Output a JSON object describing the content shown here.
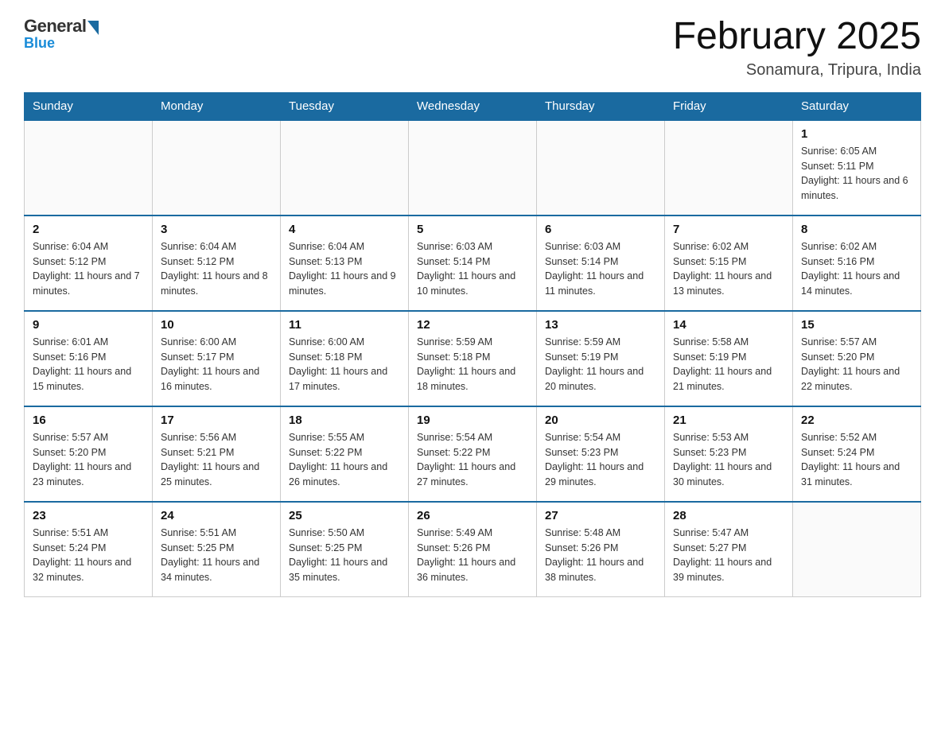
{
  "header": {
    "logo": {
      "general": "General",
      "blue": "Blue"
    },
    "title": "February 2025",
    "location": "Sonamura, Tripura, India"
  },
  "weekdays": [
    "Sunday",
    "Monday",
    "Tuesday",
    "Wednesday",
    "Thursday",
    "Friday",
    "Saturday"
  ],
  "weeks": [
    [
      {
        "day": "",
        "info": ""
      },
      {
        "day": "",
        "info": ""
      },
      {
        "day": "",
        "info": ""
      },
      {
        "day": "",
        "info": ""
      },
      {
        "day": "",
        "info": ""
      },
      {
        "day": "",
        "info": ""
      },
      {
        "day": "1",
        "info": "Sunrise: 6:05 AM\nSunset: 5:11 PM\nDaylight: 11 hours and 6 minutes."
      }
    ],
    [
      {
        "day": "2",
        "info": "Sunrise: 6:04 AM\nSunset: 5:12 PM\nDaylight: 11 hours and 7 minutes."
      },
      {
        "day": "3",
        "info": "Sunrise: 6:04 AM\nSunset: 5:12 PM\nDaylight: 11 hours and 8 minutes."
      },
      {
        "day": "4",
        "info": "Sunrise: 6:04 AM\nSunset: 5:13 PM\nDaylight: 11 hours and 9 minutes."
      },
      {
        "day": "5",
        "info": "Sunrise: 6:03 AM\nSunset: 5:14 PM\nDaylight: 11 hours and 10 minutes."
      },
      {
        "day": "6",
        "info": "Sunrise: 6:03 AM\nSunset: 5:14 PM\nDaylight: 11 hours and 11 minutes."
      },
      {
        "day": "7",
        "info": "Sunrise: 6:02 AM\nSunset: 5:15 PM\nDaylight: 11 hours and 13 minutes."
      },
      {
        "day": "8",
        "info": "Sunrise: 6:02 AM\nSunset: 5:16 PM\nDaylight: 11 hours and 14 minutes."
      }
    ],
    [
      {
        "day": "9",
        "info": "Sunrise: 6:01 AM\nSunset: 5:16 PM\nDaylight: 11 hours and 15 minutes."
      },
      {
        "day": "10",
        "info": "Sunrise: 6:00 AM\nSunset: 5:17 PM\nDaylight: 11 hours and 16 minutes."
      },
      {
        "day": "11",
        "info": "Sunrise: 6:00 AM\nSunset: 5:18 PM\nDaylight: 11 hours and 17 minutes."
      },
      {
        "day": "12",
        "info": "Sunrise: 5:59 AM\nSunset: 5:18 PM\nDaylight: 11 hours and 18 minutes."
      },
      {
        "day": "13",
        "info": "Sunrise: 5:59 AM\nSunset: 5:19 PM\nDaylight: 11 hours and 20 minutes."
      },
      {
        "day": "14",
        "info": "Sunrise: 5:58 AM\nSunset: 5:19 PM\nDaylight: 11 hours and 21 minutes."
      },
      {
        "day": "15",
        "info": "Sunrise: 5:57 AM\nSunset: 5:20 PM\nDaylight: 11 hours and 22 minutes."
      }
    ],
    [
      {
        "day": "16",
        "info": "Sunrise: 5:57 AM\nSunset: 5:20 PM\nDaylight: 11 hours and 23 minutes."
      },
      {
        "day": "17",
        "info": "Sunrise: 5:56 AM\nSunset: 5:21 PM\nDaylight: 11 hours and 25 minutes."
      },
      {
        "day": "18",
        "info": "Sunrise: 5:55 AM\nSunset: 5:22 PM\nDaylight: 11 hours and 26 minutes."
      },
      {
        "day": "19",
        "info": "Sunrise: 5:54 AM\nSunset: 5:22 PM\nDaylight: 11 hours and 27 minutes."
      },
      {
        "day": "20",
        "info": "Sunrise: 5:54 AM\nSunset: 5:23 PM\nDaylight: 11 hours and 29 minutes."
      },
      {
        "day": "21",
        "info": "Sunrise: 5:53 AM\nSunset: 5:23 PM\nDaylight: 11 hours and 30 minutes."
      },
      {
        "day": "22",
        "info": "Sunrise: 5:52 AM\nSunset: 5:24 PM\nDaylight: 11 hours and 31 minutes."
      }
    ],
    [
      {
        "day": "23",
        "info": "Sunrise: 5:51 AM\nSunset: 5:24 PM\nDaylight: 11 hours and 32 minutes."
      },
      {
        "day": "24",
        "info": "Sunrise: 5:51 AM\nSunset: 5:25 PM\nDaylight: 11 hours and 34 minutes."
      },
      {
        "day": "25",
        "info": "Sunrise: 5:50 AM\nSunset: 5:25 PM\nDaylight: 11 hours and 35 minutes."
      },
      {
        "day": "26",
        "info": "Sunrise: 5:49 AM\nSunset: 5:26 PM\nDaylight: 11 hours and 36 minutes."
      },
      {
        "day": "27",
        "info": "Sunrise: 5:48 AM\nSunset: 5:26 PM\nDaylight: 11 hours and 38 minutes."
      },
      {
        "day": "28",
        "info": "Sunrise: 5:47 AM\nSunset: 5:27 PM\nDaylight: 11 hours and 39 minutes."
      },
      {
        "day": "",
        "info": ""
      }
    ]
  ]
}
